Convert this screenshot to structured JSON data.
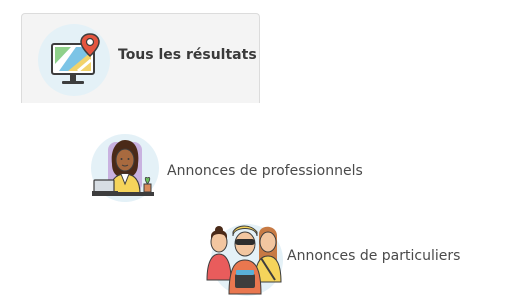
{
  "tabs": {
    "all": {
      "label": "Tous les résultats",
      "icon": "map-monitor-icon"
    },
    "pro": {
      "label": "Annonces de professionnels",
      "icon": "professional-woman-icon"
    },
    "part": {
      "label": "Annonces de particuliers",
      "icon": "private-people-icon"
    }
  },
  "colors": {
    "circle": "#e4f1f7",
    "pin": "#e4553f",
    "tab_bg": "#f4f4f4"
  }
}
